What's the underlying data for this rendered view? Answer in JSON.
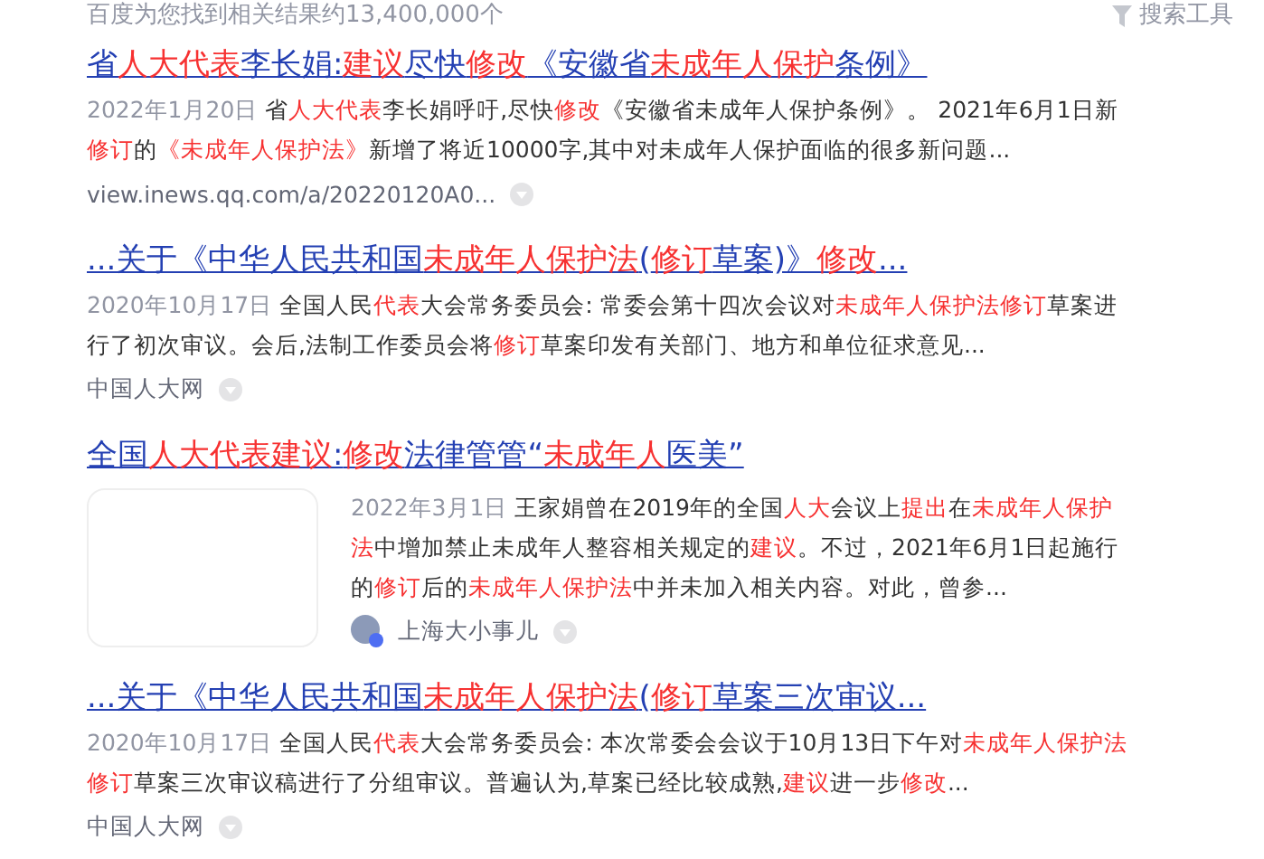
{
  "header": {
    "count_text": "百度为您找到相关结果约13,400,000个",
    "tools_label": "搜索工具"
  },
  "results": [
    {
      "kind": "plain",
      "title": [
        {
          "t": "省",
          "hl": false
        },
        {
          "t": "人大代表",
          "hl": true
        },
        {
          "t": "李长娟:",
          "hl": false
        },
        {
          "t": "建议",
          "hl": true
        },
        {
          "t": "尽快",
          "hl": false
        },
        {
          "t": "修改",
          "hl": true
        },
        {
          "t": "《安徽省",
          "hl": false
        },
        {
          "t": "未成年人保护",
          "hl": true
        },
        {
          "t": "条例》",
          "hl": false
        }
      ],
      "date": "2022年1月20日",
      "snippet": [
        {
          "t": "省",
          "hl": false
        },
        {
          "t": "人大代表",
          "hl": true
        },
        {
          "t": "李长娟呼吁,尽快",
          "hl": false
        },
        {
          "t": "修改",
          "hl": true
        },
        {
          "t": "《安徽省未成年人保护条例》。 2021年6月1日新",
          "hl": false
        },
        {
          "t": "修订",
          "hl": true
        },
        {
          "t": "的",
          "hl": false
        },
        {
          "t": "《未成年人保护法》",
          "hl": true
        },
        {
          "t": "新增了将近10000字,其中对未成年人保护面临的很多新问题...",
          "hl": false
        }
      ],
      "source": "view.inews.qq.com/a/20220120A0..."
    },
    {
      "kind": "plain",
      "title": [
        {
          "t": "...关于《中华人民共和国",
          "hl": false
        },
        {
          "t": "未成年人保护法",
          "hl": true
        },
        {
          "t": "(",
          "hl": false
        },
        {
          "t": "修订",
          "hl": true
        },
        {
          "t": "草案)》",
          "hl": false
        },
        {
          "t": "修改",
          "hl": true
        },
        {
          "t": "...",
          "hl": false
        }
      ],
      "date": "2020年10月17日",
      "snippet": [
        {
          "t": "全国人民",
          "hl": false
        },
        {
          "t": "代表",
          "hl": true
        },
        {
          "t": "大会常务委员会: 常委会第十四次会议对",
          "hl": false
        },
        {
          "t": "未成年人保护法修订",
          "hl": true
        },
        {
          "t": "草案进行了初次审议。会后,法制工作委员会将",
          "hl": false
        },
        {
          "t": "修订",
          "hl": true
        },
        {
          "t": "草案印发有关部门、地方和单位征求意见...",
          "hl": false
        }
      ],
      "source": "中国人大网"
    },
    {
      "kind": "with_thumbnail",
      "title": [
        {
          "t": "全国",
          "hl": false
        },
        {
          "t": "人大代表建议",
          "hl": true
        },
        {
          "t": ":",
          "hl": false
        },
        {
          "t": "修改",
          "hl": true
        },
        {
          "t": "法律管管“",
          "hl": false
        },
        {
          "t": "未成年人",
          "hl": true
        },
        {
          "t": "医美”",
          "hl": false
        }
      ],
      "date": "2022年3月1日",
      "snippet": [
        {
          "t": "王家娟曾在2019年的全国",
          "hl": false
        },
        {
          "t": "人大",
          "hl": true
        },
        {
          "t": "会议上",
          "hl": false
        },
        {
          "t": "提出",
          "hl": true
        },
        {
          "t": "在",
          "hl": false
        },
        {
          "t": "未成年人保护法",
          "hl": true
        },
        {
          "t": "中增加禁止未成年人整容相关规定的",
          "hl": false
        },
        {
          "t": "建议",
          "hl": true
        },
        {
          "t": "。不过，2021年6月1日起施行的",
          "hl": false
        },
        {
          "t": "修订",
          "hl": true
        },
        {
          "t": "后的",
          "hl": false
        },
        {
          "t": "未成年人保护法",
          "hl": true
        },
        {
          "t": "中并未加入相关内容。对此，曾参...",
          "hl": false
        }
      ],
      "source": "上海大小事儿"
    },
    {
      "kind": "plain",
      "title": [
        {
          "t": "...关于《中华人民共和国",
          "hl": false
        },
        {
          "t": "未成年人保护法",
          "hl": true
        },
        {
          "t": "(",
          "hl": false
        },
        {
          "t": "修订",
          "hl": true
        },
        {
          "t": "草案三次审议...",
          "hl": false
        }
      ],
      "date": "2020年10月17日",
      "snippet": [
        {
          "t": "全国人民",
          "hl": false
        },
        {
          "t": "代表",
          "hl": true
        },
        {
          "t": "大会常务委员会: 本次常委会会议于10月13日下午对",
          "hl": false
        },
        {
          "t": "未成年人保护法修订",
          "hl": true
        },
        {
          "t": "草案三次审议稿进行了分组审议。普遍认为,草案已经比较成熟,",
          "hl": false
        },
        {
          "t": "建议",
          "hl": true
        },
        {
          "t": "进一步",
          "hl": false
        },
        {
          "t": "修改",
          "hl": true
        },
        {
          "t": "...",
          "hl": false
        }
      ],
      "source": "中国人大网"
    }
  ]
}
